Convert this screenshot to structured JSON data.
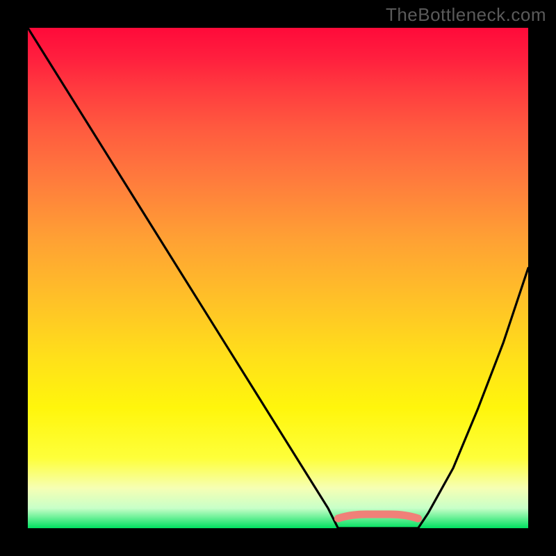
{
  "watermark": "TheBottleneck.com",
  "chart_data": {
    "type": "line",
    "title": "",
    "xlabel": "",
    "ylabel": "",
    "xlim": [
      0,
      100
    ],
    "ylim": [
      0,
      100
    ],
    "x": [
      0,
      5,
      10,
      15,
      20,
      25,
      30,
      35,
      40,
      45,
      50,
      55,
      60,
      62,
      65,
      70,
      75,
      78,
      80,
      85,
      90,
      95,
      100
    ],
    "values": [
      100,
      92,
      84,
      76,
      68,
      60,
      52,
      44,
      36,
      28,
      20,
      12,
      4,
      0,
      0,
      0,
      0,
      0,
      3,
      12,
      24,
      37,
      52
    ],
    "plateau_segment": {
      "x_start": 62,
      "x_end": 78,
      "y": 2.5,
      "color": "#f08078"
    },
    "gradient_stops": [
      {
        "pos": 0,
        "color": "#ff0a3a"
      },
      {
        "pos": 100,
        "color": "#00e060"
      }
    ]
  },
  "colors": {
    "frame": "#000000",
    "curve": "#000000",
    "plateau": "#f08078",
    "watermark": "#5a5a5a"
  }
}
